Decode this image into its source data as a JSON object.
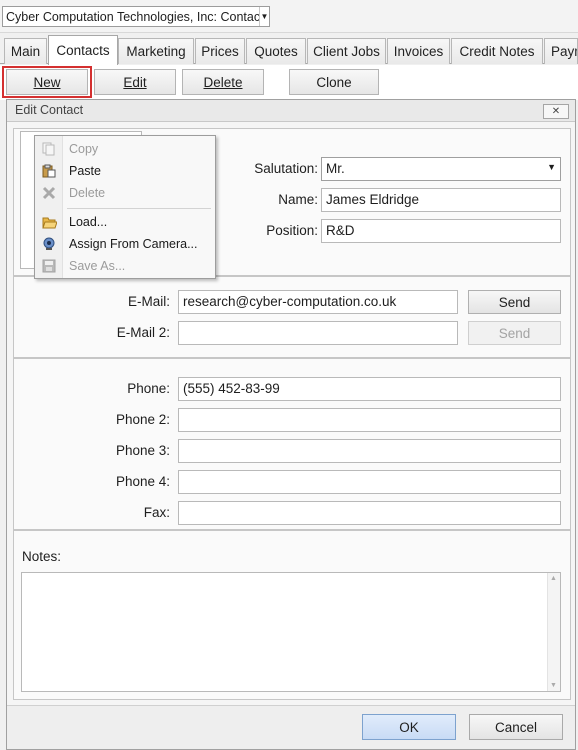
{
  "company_selector": {
    "value": "Cyber Computation Technologies, Inc: Contacts"
  },
  "tabs": [
    {
      "label": "Main"
    },
    {
      "label": "Contacts"
    },
    {
      "label": "Marketing"
    },
    {
      "label": "Prices"
    },
    {
      "label": "Quotes"
    },
    {
      "label": "Client Jobs"
    },
    {
      "label": "Invoices"
    },
    {
      "label": "Credit Notes"
    },
    {
      "label": "Paym"
    }
  ],
  "active_tab": "Contacts",
  "toolbar": {
    "new_label": "New",
    "edit_label": "Edit",
    "delete_label": "Delete",
    "clone_label": "Clone"
  },
  "dialog": {
    "title": "Edit Contact",
    "close_glyph": "✕",
    "salutation": {
      "label": "Salutation:",
      "value": "Mr."
    },
    "name": {
      "label": "Name:",
      "value": "James Eldridge"
    },
    "position": {
      "label": "Position:",
      "value": "R&D"
    },
    "email": {
      "label": "E-Mail:",
      "value": "research@cyber-computation.co.uk",
      "send": "Send"
    },
    "email2": {
      "label": "E-Mail 2:",
      "value": "",
      "send": "Send"
    },
    "phone": {
      "label": "Phone:",
      "value": "(555) 452-83-99"
    },
    "phone2": {
      "label": "Phone 2:",
      "value": ""
    },
    "phone3": {
      "label": "Phone 3:",
      "value": ""
    },
    "phone4": {
      "label": "Phone 4:",
      "value": ""
    },
    "fax": {
      "label": "Fax:",
      "value": ""
    },
    "notes": {
      "label": "Notes:",
      "value": ""
    },
    "ok": "OK",
    "cancel": "Cancel"
  },
  "context_menu": {
    "items": [
      {
        "label": "Copy",
        "icon": "copy-icon",
        "enabled": false
      },
      {
        "label": "Paste",
        "icon": "paste-icon",
        "enabled": true
      },
      {
        "label": "Delete",
        "icon": "delete-x-icon",
        "enabled": false
      },
      {
        "label": "Load...",
        "icon": "folder-open-icon",
        "enabled": true
      },
      {
        "label": "Assign From Camera...",
        "icon": "webcam-icon",
        "enabled": true
      },
      {
        "label": "Save As...",
        "icon": "floppy-disk-icon",
        "enabled": false
      }
    ]
  },
  "colors": {
    "highlight": "#d43030",
    "primary_button": "#c8dbf5",
    "disabled_text": "#9b9b9b"
  }
}
